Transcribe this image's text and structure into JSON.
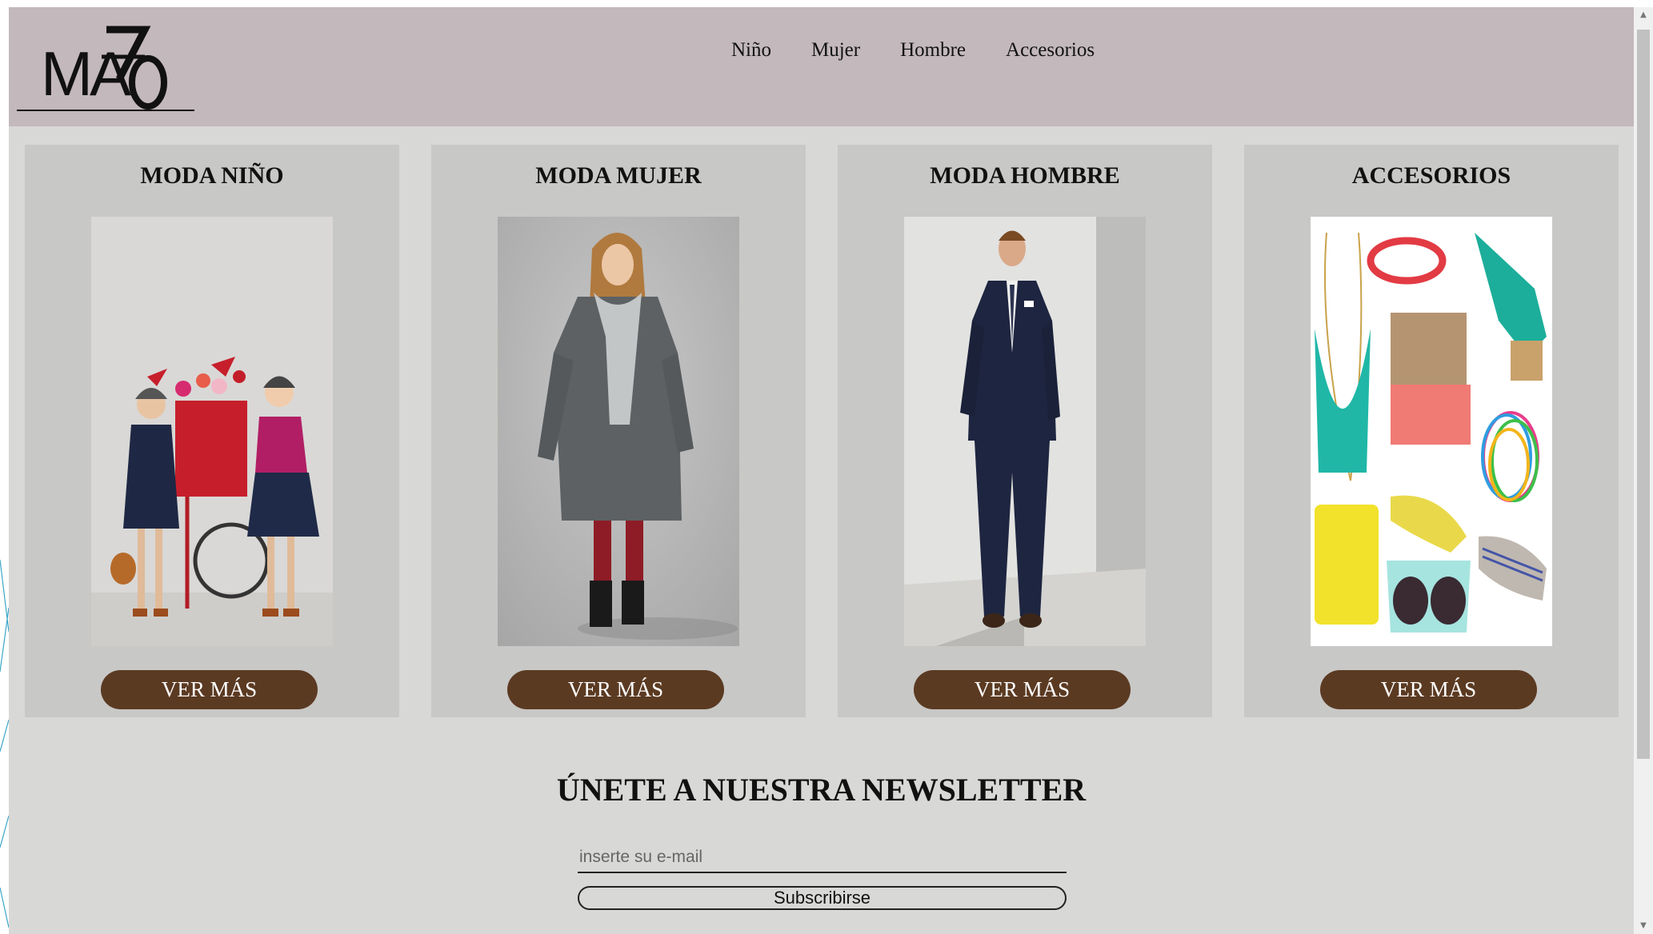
{
  "brand": {
    "logo_text": "MAZO"
  },
  "nav": {
    "items": [
      {
        "label": "Niño"
      },
      {
        "label": "Mujer"
      },
      {
        "label": "Hombre"
      },
      {
        "label": "Accesorios"
      }
    ]
  },
  "cards": [
    {
      "title": "MODA NIÑO",
      "button": "VER MÁS",
      "image": "kids-fashion-photo"
    },
    {
      "title": "MODA MUJER",
      "button": "VER MÁS",
      "image": "women-coat-photo"
    },
    {
      "title": "MODA HOMBRE",
      "button": "VER MÁS",
      "image": "men-suit-photo"
    },
    {
      "title": "ACCESORIOS",
      "button": "VER MÁS",
      "image": "accessories-collage-photo"
    }
  ],
  "newsletter": {
    "title": "ÚNETE A NUESTRA NEWSLETTER",
    "email_placeholder": "inserte su e-mail",
    "email_value": "",
    "submit_label": "Subscribirse"
  },
  "colors": {
    "header_bg": "#c3b8bb",
    "page_bg": "#d8d8d6",
    "card_bg": "#c8c8c6",
    "button_bg": "#5b3a22",
    "button_text": "#ffffff"
  }
}
